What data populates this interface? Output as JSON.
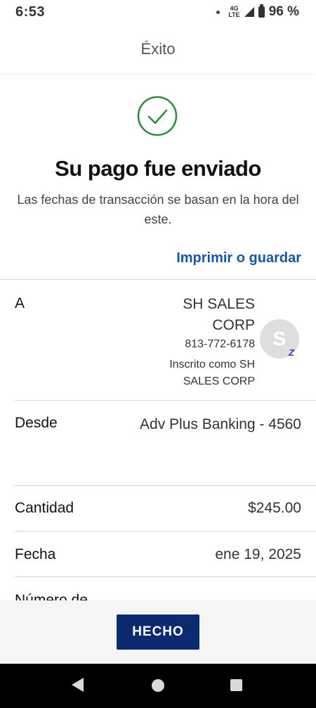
{
  "status_bar": {
    "time": "6:53",
    "network": "4G",
    "network_sub": "LTE",
    "battery": "96 %"
  },
  "header": {
    "title": "Éxito"
  },
  "confirmation": {
    "headline": "Su pago fue enviado",
    "subtext": "Las fechas de transacción se basan en la hora del este.",
    "print_link": "Imprimir o guardar",
    "success_color": "#2e8b3a"
  },
  "details": {
    "to": {
      "label": "A",
      "name": "SH SALES CORP",
      "phone": "813-772-6178",
      "enrolled": "Inscrito como SH SALES CORP",
      "avatar_initial": "S",
      "badge": "Z"
    },
    "from": {
      "label": "Desde",
      "value": "Adv Plus Banking - 4560"
    },
    "amount": {
      "label": "Cantidad",
      "value": "$245.00"
    },
    "date": {
      "label": "Fecha",
      "value": "ene 19, 2025"
    },
    "number": {
      "label": "Número de"
    }
  },
  "footer": {
    "done_label": "HECHO"
  },
  "colors": {
    "accent": "#1a56a8",
    "button": "#0b2a6f"
  }
}
